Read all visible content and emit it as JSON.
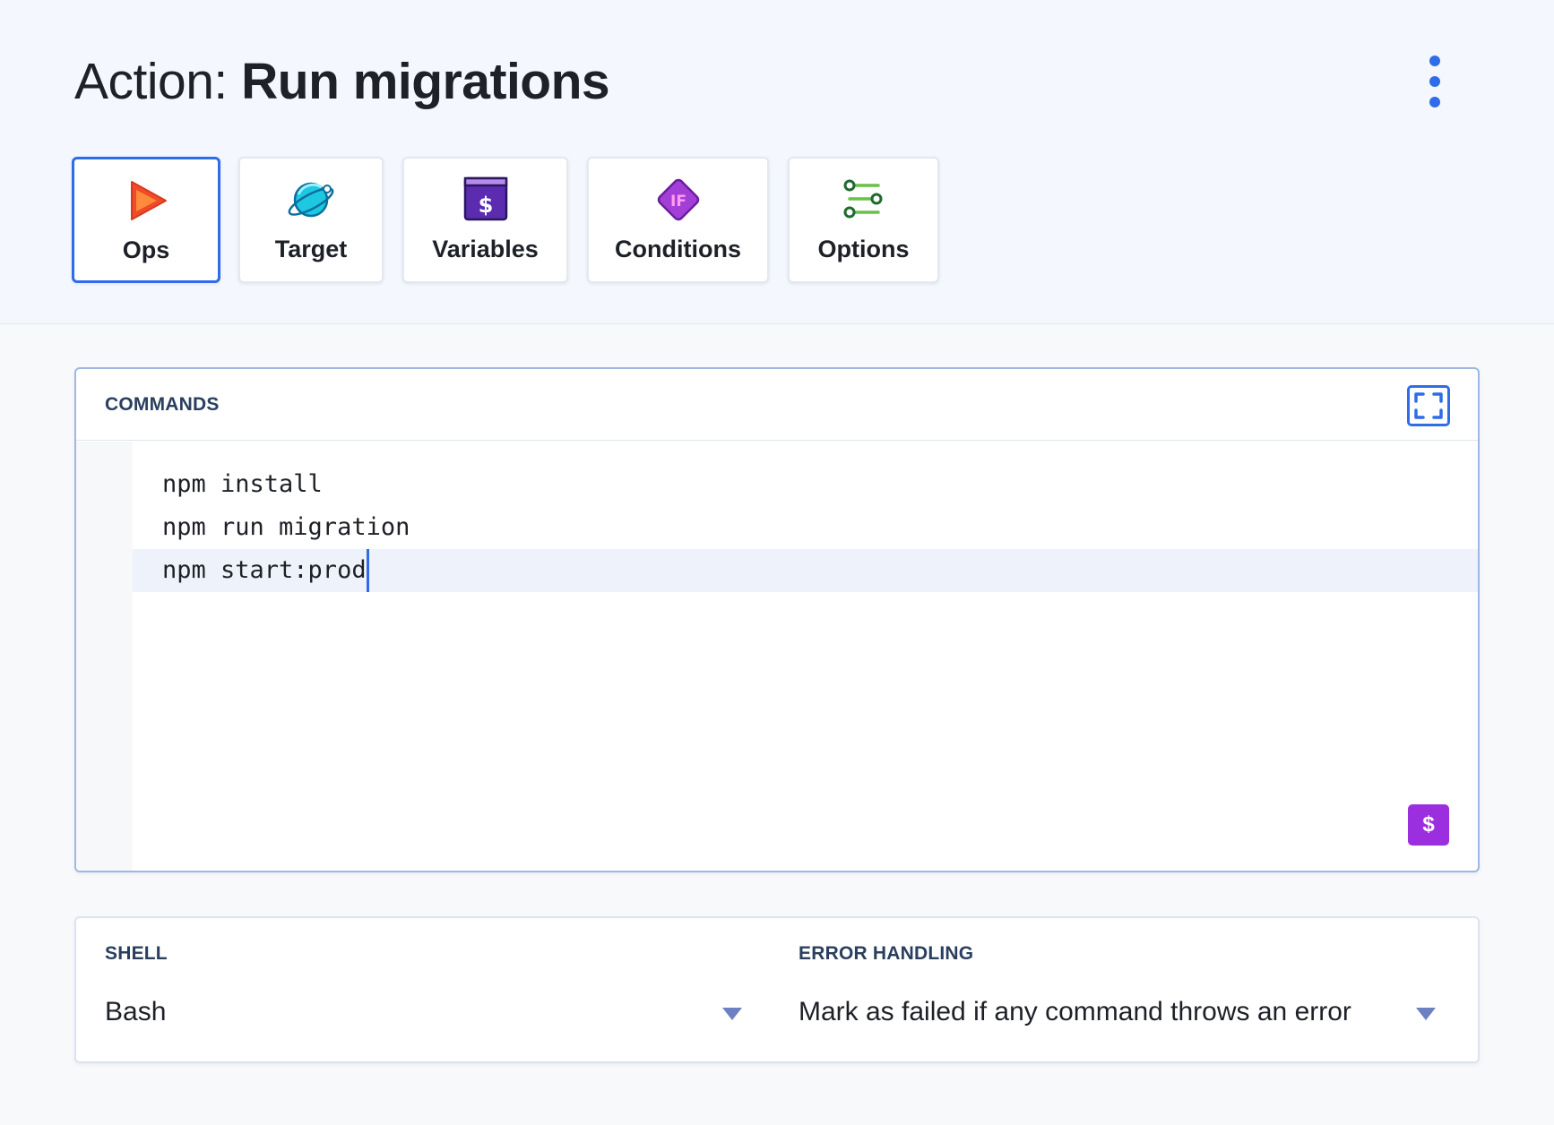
{
  "header": {
    "title_prefix": "Action:",
    "title_name": "Run migrations",
    "menu_icon": "more-vertical-icon"
  },
  "tabs": [
    {
      "label": "Ops",
      "icon": "play-icon",
      "active": true
    },
    {
      "label": "Target",
      "icon": "planet-icon",
      "active": false
    },
    {
      "label": "Variables",
      "icon": "variables-icon",
      "active": false
    },
    {
      "label": "Conditions",
      "icon": "if-diamond-icon",
      "active": false
    },
    {
      "label": "Options",
      "icon": "sliders-icon",
      "active": false
    }
  ],
  "commands": {
    "label": "COMMANDS",
    "expand_icon": "fullscreen-icon",
    "lines": [
      "npm install",
      "npm run migration",
      "npm start:prod"
    ],
    "insert_variable_label": "$"
  },
  "settings": {
    "shell": {
      "label": "SHELL",
      "value": "Bash"
    },
    "error_handling": {
      "label": "ERROR HANDLING",
      "value": "Mark as failed if any command throws an error"
    }
  },
  "colors": {
    "accent": "#2f6ce9",
    "variable_button": "#9b2fe0",
    "section_label": "#2a3f5f"
  }
}
